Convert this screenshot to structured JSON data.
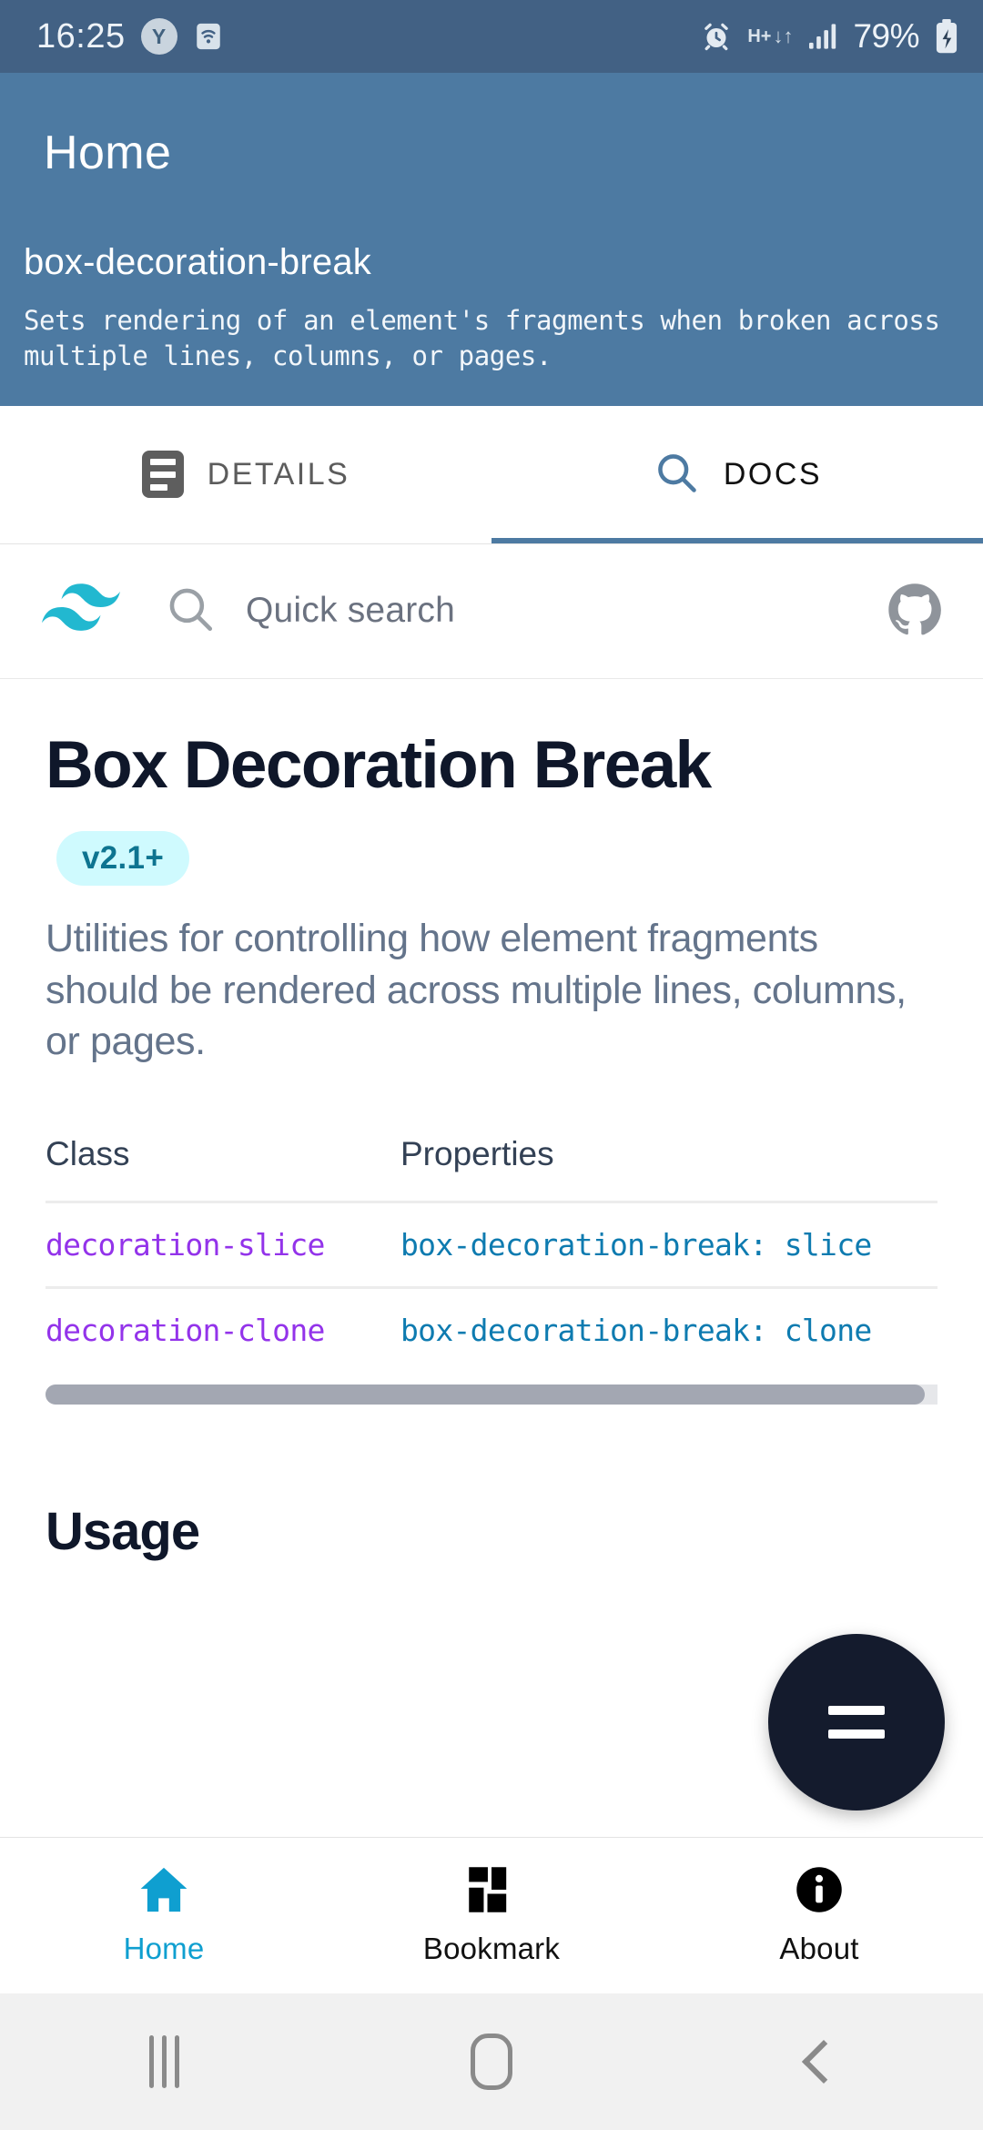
{
  "status_bar": {
    "time": "16:25",
    "profile_badge": "Y",
    "wifi_icon": "wifi-icon",
    "alarm_icon": "alarm-icon",
    "network_type": "H+",
    "data_transfer_icon": "data-transfer-icon",
    "signal_icon": "signal-bars-icon",
    "battery_percent": "79%",
    "battery_icon": "battery-charging-icon"
  },
  "app_header": {
    "title": "Home",
    "entry_name": "box-decoration-break",
    "entry_description": "Sets rendering of an element's fragments when broken across multiple lines, columns, or pages.",
    "background_color": "#4d7aa2"
  },
  "tabs": [
    {
      "label": "DETAILS",
      "icon": "article-icon",
      "active": false
    },
    {
      "label": "DOCS",
      "icon": "search-icon",
      "active": true
    }
  ],
  "docs_toolbar": {
    "logo_icon": "tailwind-logo-icon",
    "search_icon": "search-icon",
    "search_placeholder": "Quick search",
    "search_value": "",
    "github_icon": "github-icon",
    "accent_color": "#22b8d0"
  },
  "doc": {
    "title": "Box Decoration Break",
    "version_badge": "v2.1+",
    "badge_bg": "#cffafe",
    "badge_fg": "#0e7490",
    "description": "Utilities for controlling how element fragments should be rendered across multiple lines, columns, or pages.",
    "table": {
      "headers": [
        "Class",
        "Properties"
      ],
      "rows": [
        {
          "class": "decoration-slice",
          "properties": "box-decoration-break: slice"
        },
        {
          "class": "decoration-clone",
          "properties": "box-decoration-break: clone"
        }
      ],
      "class_color": "#9333ea",
      "property_color": "#0e7bb0"
    },
    "section_heading": "Usage"
  },
  "fab": {
    "icon": "menu-equals-icon",
    "background_color": "#141b2d"
  },
  "bottom_nav": [
    {
      "label": "Home",
      "icon": "home-icon",
      "active": true
    },
    {
      "label": "Bookmark",
      "icon": "dashboard-grid-icon",
      "active": false
    },
    {
      "label": "About",
      "icon": "info-circle-icon",
      "active": false
    }
  ],
  "android_nav": {
    "recents": "recents-icon",
    "home": "home-button-icon",
    "back": "back-icon"
  }
}
